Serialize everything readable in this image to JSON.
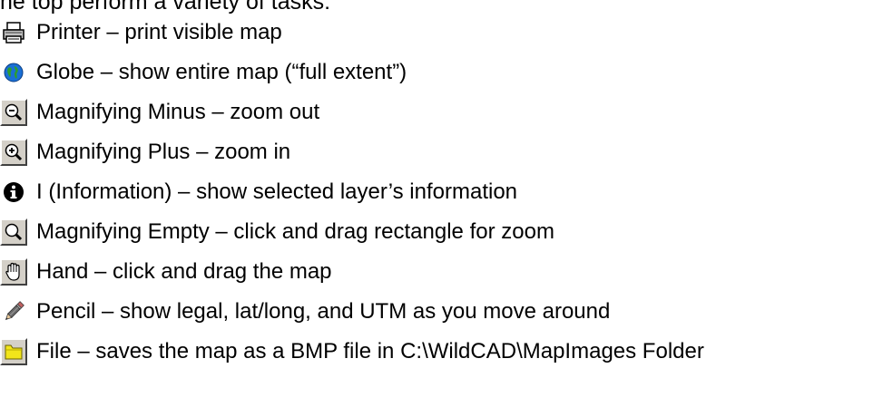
{
  "intro": "he top perform a variety of tasks:",
  "items": [
    {
      "icon": "printer-icon",
      "label": "Printer – print visible map"
    },
    {
      "icon": "globe-icon",
      "label": "Globe – show entire map (“full extent”)"
    },
    {
      "icon": "zoom-out-icon",
      "label": "Magnifying Minus – zoom out"
    },
    {
      "icon": "zoom-in-icon",
      "label": "Magnifying Plus – zoom in"
    },
    {
      "icon": "info-icon",
      "label": "I (Information) – show selected layer’s information"
    },
    {
      "icon": "zoom-rectangle-icon",
      "label": "Magnifying Empty – click and drag rectangle for zoom"
    },
    {
      "icon": "hand-icon",
      "label": "Hand – click and drag the map"
    },
    {
      "icon": "pencil-icon",
      "label": "Pencil – show legal, lat/long, and UTM as you move around"
    },
    {
      "icon": "folder-icon",
      "label": "File – saves the map as a BMP file in C:\\WildCAD\\MapImages Folder"
    }
  ]
}
